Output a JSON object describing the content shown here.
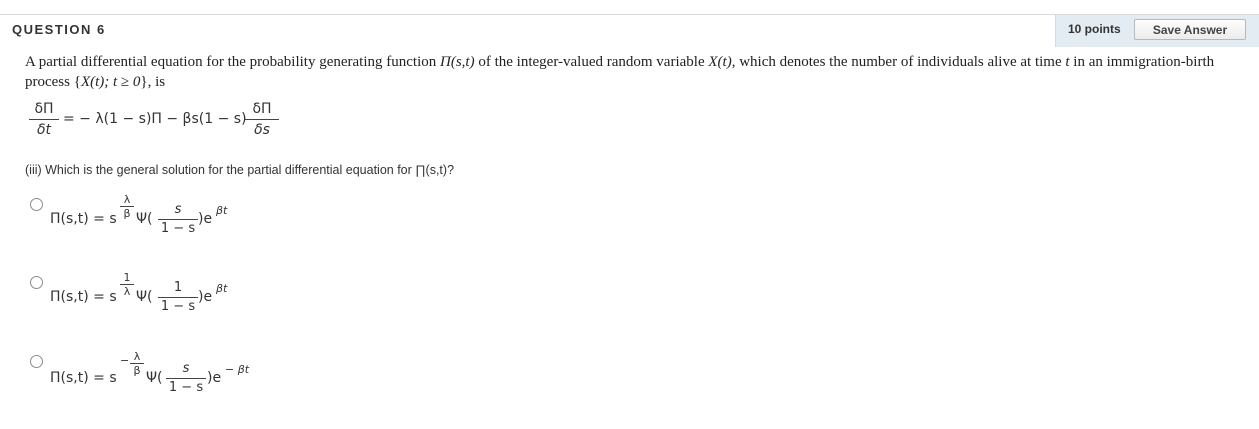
{
  "header": {
    "title": "QUESTION 6",
    "points": "10 points",
    "save_label": "Save Answer"
  },
  "question": {
    "stem_1": "A partial differential equation for the probability generating function ",
    "stem_pi": "Π(s,t)",
    "stem_2": " of the integer-valued random variable ",
    "stem_x": "X(t)",
    "stem_3": ", which denotes the number of individuals alive at time ",
    "stem_t": "t",
    "stem_4": " in an immigration-birth process {",
    "stem_set": "X(t); t ≥ 0",
    "stem_5": "}, is",
    "equation": {
      "lhs_num": "δΠ",
      "lhs_den": "δt",
      "middle": "= − λ(1 − s)Π − βs(1 − s)",
      "rhs_num": "δΠ",
      "rhs_den": "δs"
    },
    "prompt": "(iii) Which is the general solution for the partial differential equation for ∏(s,t)?"
  },
  "options": [
    {
      "lhs": "Π(s,t) = s",
      "exp_num": "λ",
      "exp_den": "β",
      "exp_sign": "",
      "psi": "Ψ(",
      "arg_num": "s",
      "arg_den": "1 − s",
      "tail": ")e",
      "tail_exp": "βt"
    },
    {
      "lhs": "Π(s,t) = s",
      "exp_num": "1",
      "exp_den": "λ",
      "exp_sign": "",
      "psi": "Ψ(",
      "arg_num": "1",
      "arg_den": "1 − s",
      "tail": ")e",
      "tail_exp": "βt"
    },
    {
      "lhs": "Π(s,t) = s",
      "exp_num": "λ",
      "exp_den": "β",
      "exp_sign": "−",
      "psi": "Ψ(",
      "arg_num": "s",
      "arg_den": "1 − s",
      "tail": ")e",
      "tail_exp": "− βt"
    }
  ]
}
